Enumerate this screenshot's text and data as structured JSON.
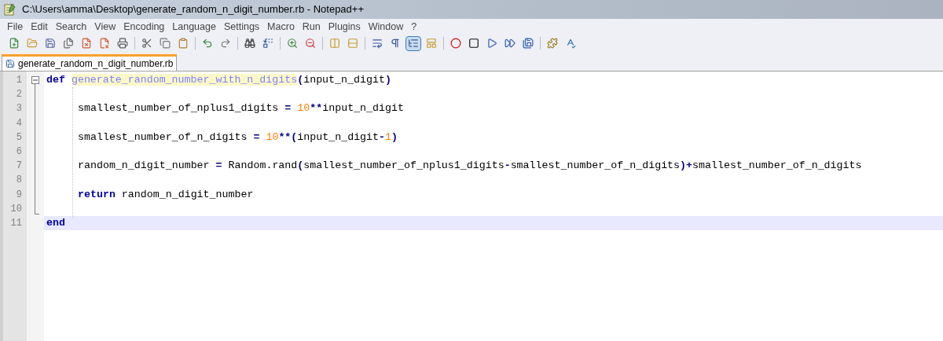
{
  "window": {
    "title": "C:\\Users\\amma\\Desktop\\generate_random_n_digit_number.rb - Notepad++"
  },
  "menu": [
    "File",
    "Edit",
    "Search",
    "View",
    "Encoding",
    "Language",
    "Settings",
    "Macro",
    "Run",
    "Plugins",
    "Window",
    "?"
  ],
  "toolbar": [
    {
      "kind": "new",
      "pressed": false
    },
    {
      "kind": "open",
      "pressed": false
    },
    {
      "kind": "save",
      "pressed": false
    },
    {
      "kind": "save-all",
      "pressed": false
    },
    {
      "kind": "close",
      "pressed": false
    },
    {
      "kind": "close-all",
      "pressed": false
    },
    {
      "kind": "print",
      "pressed": false
    },
    {
      "kind": "sep"
    },
    {
      "kind": "cut",
      "pressed": false
    },
    {
      "kind": "copy",
      "pressed": false
    },
    {
      "kind": "paste",
      "pressed": false
    },
    {
      "kind": "sep"
    },
    {
      "kind": "undo",
      "pressed": false
    },
    {
      "kind": "redo",
      "pressed": false
    },
    {
      "kind": "sep"
    },
    {
      "kind": "find",
      "pressed": false
    },
    {
      "kind": "replace",
      "pressed": false
    },
    {
      "kind": "sep"
    },
    {
      "kind": "zoom-in",
      "pressed": false
    },
    {
      "kind": "zoom-out",
      "pressed": false
    },
    {
      "kind": "sep"
    },
    {
      "kind": "sync-v",
      "pressed": false
    },
    {
      "kind": "sync-h",
      "pressed": false
    },
    {
      "kind": "sep"
    },
    {
      "kind": "wrap",
      "pressed": false
    },
    {
      "kind": "all-chars",
      "pressed": false
    },
    {
      "kind": "indent-guide",
      "pressed": true
    },
    {
      "kind": "udl",
      "pressed": false
    },
    {
      "kind": "sep"
    },
    {
      "kind": "record",
      "pressed": false
    },
    {
      "kind": "stop",
      "pressed": false
    },
    {
      "kind": "play",
      "pressed": false
    },
    {
      "kind": "play-multi",
      "pressed": false
    },
    {
      "kind": "save-macro",
      "pressed": false
    },
    {
      "kind": "sep"
    },
    {
      "kind": "plugin",
      "pressed": false
    },
    {
      "kind": "spell",
      "pressed": false
    }
  ],
  "tabs": [
    {
      "label": "generate_random_n_digit_number.rb",
      "selected": true
    }
  ],
  "editor": {
    "lines": [
      {
        "number": "1",
        "indented": false,
        "current": false,
        "tokens": [
          {
            "kind": "keyword",
            "text": "def "
          },
          {
            "kind": "function",
            "text": "generate_random_number_with_n_digits"
          },
          {
            "kind": "operator",
            "text": "("
          },
          {
            "kind": "plain",
            "text": "input_n_digit"
          },
          {
            "kind": "operator",
            "text": ")"
          }
        ]
      },
      {
        "number": "2"
      },
      {
        "number": "3",
        "indented": true,
        "current": false,
        "tokens": [
          {
            "kind": "plain",
            "text": "smallest_number_of_nplus1_digits "
          },
          {
            "kind": "operator",
            "text": "= "
          },
          {
            "kind": "number",
            "text": "10"
          },
          {
            "kind": "operator",
            "text": "**"
          },
          {
            "kind": "plain",
            "text": "input_n_digit"
          }
        ]
      },
      {
        "number": "4"
      },
      {
        "number": "5",
        "indented": true,
        "current": false,
        "tokens": [
          {
            "kind": "plain",
            "text": "smallest_number_of_n_digits "
          },
          {
            "kind": "operator",
            "text": "= "
          },
          {
            "kind": "number",
            "text": "10"
          },
          {
            "kind": "operator",
            "text": "**("
          },
          {
            "kind": "plain",
            "text": "input_n_digit"
          },
          {
            "kind": "operator",
            "text": "-"
          },
          {
            "kind": "number",
            "text": "1"
          },
          {
            "kind": "operator",
            "text": ")"
          }
        ]
      },
      {
        "number": "6"
      },
      {
        "number": "7",
        "indented": true,
        "current": false,
        "tokens": [
          {
            "kind": "plain",
            "text": "random_n_digit_number "
          },
          {
            "kind": "operator",
            "text": "="
          },
          {
            "kind": "plain",
            "text": " Random.rand"
          },
          {
            "kind": "operator",
            "text": "("
          },
          {
            "kind": "plain",
            "text": "smallest_number_of_nplus1_digits"
          },
          {
            "kind": "operator",
            "text": "-"
          },
          {
            "kind": "plain",
            "text": "smallest_number_of_n_digits"
          },
          {
            "kind": "operator",
            "text": ")+"
          },
          {
            "kind": "plain",
            "text": "smallest_number_of_n_digits"
          }
        ]
      },
      {
        "number": "8"
      },
      {
        "number": "9",
        "indented": true,
        "current": false,
        "tokens": [
          {
            "kind": "keyword",
            "text": "return"
          },
          {
            "kind": "plain",
            "text": " random_n_digit_number"
          }
        ]
      },
      {
        "number": "10"
      },
      {
        "number": "11",
        "indented": false,
        "current": true,
        "tokens": [
          {
            "kind": "keyword",
            "text": "end"
          }
        ]
      }
    ]
  }
}
